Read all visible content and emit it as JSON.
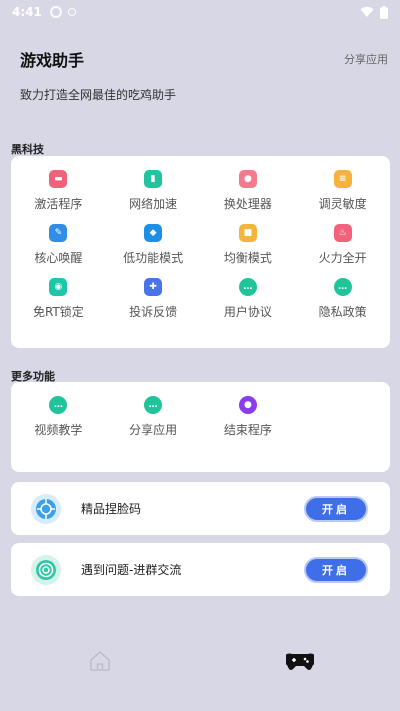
{
  "status": {
    "time": "4:41"
  },
  "header": {
    "title": "游戏助手",
    "share": "分享应用"
  },
  "subtitle": "致力打造全网最佳的吃鸡助手",
  "sections": {
    "tech": {
      "label": "黑科技",
      "items": [
        {
          "label": "激活程序",
          "icon": "monitor-icon",
          "color": "#f0627a"
        },
        {
          "label": "网络加速",
          "icon": "notebook-icon",
          "color": "#22c4a0"
        },
        {
          "label": "换处理器",
          "icon": "chip-icon",
          "color": "#f47b8e"
        },
        {
          "label": "调灵敏度",
          "icon": "sliders-icon",
          "color": "#f6b23c"
        },
        {
          "label": "核心唤醒",
          "icon": "pen-icon",
          "color": "#2f8fe8"
        },
        {
          "label": "低功能模式",
          "icon": "layers-icon",
          "color": "#1e8fe6"
        },
        {
          "label": "均衡模式",
          "icon": "box-icon",
          "color": "#f3b53c"
        },
        {
          "label": "火力全开",
          "icon": "flame-icon",
          "color": "#f2627c"
        },
        {
          "label": "免RT锁定",
          "icon": "lock-icon",
          "color": "#1ec5a8"
        },
        {
          "label": "投诉反馈",
          "icon": "gamepad-icon",
          "color": "#4b73e8"
        },
        {
          "label": "用户协议",
          "icon": "chat-icon",
          "color": "#20c49a"
        },
        {
          "label": "隐私政策",
          "icon": "chat-icon",
          "color": "#20c49a"
        }
      ]
    },
    "more": {
      "label": "更多功能",
      "items": [
        {
          "label": "视频教学",
          "icon": "chat-icon",
          "color": "#20c49a"
        },
        {
          "label": "分享应用",
          "icon": "chat-icon",
          "color": "#20c49a"
        },
        {
          "label": "结束程序",
          "icon": "circles-icon",
          "color": "#8a3df0"
        }
      ]
    }
  },
  "rows": [
    {
      "label": "精品捏脸码",
      "button": "开启",
      "icon": "aperture-icon",
      "color": "#3aa0e8"
    },
    {
      "label": "遇到问题-进群交流",
      "button": "开启",
      "icon": "target-icon",
      "color": "#36c6a6"
    }
  ],
  "nav": {
    "home": "home-icon",
    "game": "gamepad-icon"
  }
}
